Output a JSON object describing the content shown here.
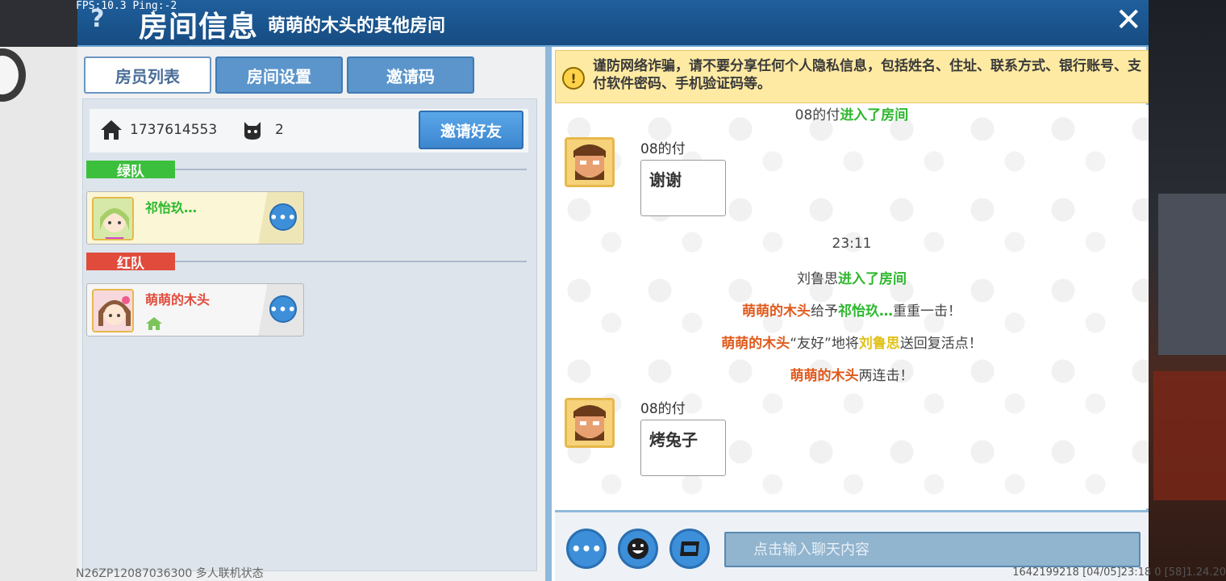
{
  "overlay": {
    "fps": "FPS:10.3  Ping:-2",
    "build_status": "N26ZP12087036300 多人联机状态",
    "footer_info": "1642199218    [04/05]23:18 0    [58]1.24.20"
  },
  "header": {
    "help": "?",
    "title": "房间信息",
    "subtitle": "萌萌的木头的其他房间",
    "close": "✕"
  },
  "tabs": [
    {
      "label": "房员列表",
      "active": true
    },
    {
      "label": "房间设置",
      "active": false
    },
    {
      "label": "邀请码",
      "active": false
    }
  ],
  "room": {
    "id": "1737614553",
    "player_count": "2",
    "invite_label": "邀请好友"
  },
  "teams": {
    "green": {
      "label": "绿队",
      "members": [
        {
          "name": "祁怡玖…",
          "more": "•••"
        }
      ]
    },
    "red": {
      "label": "红队",
      "members": [
        {
          "name": "萌萌的木头",
          "more": "•••",
          "is_host": true
        }
      ]
    }
  },
  "chat": {
    "warning": "谨防网络诈骗，请不要分享任何个人隐私信息，包括姓名、住址、联系方式、银行账号、支付软件密码、手机验证码等。",
    "sys1": {
      "name": "08的付",
      "action": "进入了房间"
    },
    "msg1": {
      "sender": "08的付",
      "text": "谢谢"
    },
    "time": "23:11",
    "sys2": {
      "name": "刘鲁思",
      "action": "进入了房间"
    },
    "sys3": {
      "attacker": "萌萌的木头",
      "verb": "给予",
      "target": "祁怡玖…",
      "result": "重重一击！"
    },
    "sys4": {
      "actor": "萌萌的木头",
      "quote": "“友好”",
      "verb": "地将",
      "target": "刘鲁思",
      "result": "送回复活点！"
    },
    "sys5": {
      "actor": "萌萌的木头",
      "result": "两连击！"
    },
    "msg2": {
      "sender": "08的付",
      "text": "烤兔子"
    },
    "more_btn": "•••",
    "input_placeholder": "点击输入聊天内容"
  }
}
